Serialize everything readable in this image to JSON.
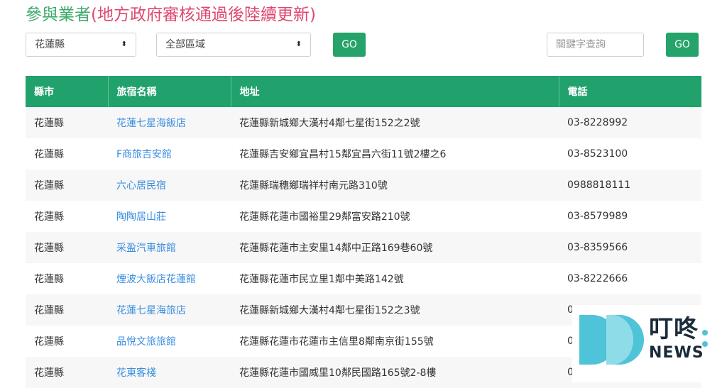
{
  "page": {
    "title_main": "參與業者",
    "title_note": "(地方政府審核通過後陸續更新)"
  },
  "filters": {
    "county": {
      "selected": "花蓮縣",
      "caret": "⬍"
    },
    "district": {
      "selected": "全部區域",
      "caret": "⬍"
    },
    "go_label": "GO",
    "keyword_placeholder": "關鍵字查詢",
    "search_go_label": "GO"
  },
  "table": {
    "headers": [
      "縣市",
      "旅宿名稱",
      "地址",
      "電話"
    ],
    "rows": [
      {
        "county": "花蓮縣",
        "name": "花蓮七星海飯店",
        "address": "花蓮縣新城鄉大漢村4鄰七星街152之2號",
        "phone": "03-8228992"
      },
      {
        "county": "花蓮縣",
        "name": "F商旅吉安館",
        "address": "花蓮縣吉安鄉宜昌村15鄰宜昌六街11號2樓之6",
        "phone": "03-8523100"
      },
      {
        "county": "花蓮縣",
        "name": "六心居民宿",
        "address": "花蓮縣瑞穗鄉瑞祥村南元路310號",
        "phone": "0988818111"
      },
      {
        "county": "花蓮縣",
        "name": "陶陶居山莊",
        "address": "花蓮縣花蓮市國裕里29鄰富安路210號",
        "phone": "03-8579989"
      },
      {
        "county": "花蓮縣",
        "name": "采盈汽車旅館",
        "address": "花蓮縣花蓮市主安里14鄰中正路169巷60號",
        "phone": "03-8359566"
      },
      {
        "county": "花蓮縣",
        "name": "煙波大飯店花蓮館",
        "address": "花蓮縣花蓮市民立里1鄰中美路142號",
        "phone": "03-8222666"
      },
      {
        "county": "花蓮縣",
        "name": "花蓮七星海旅店",
        "address": "花蓮縣新城鄉大漢村4鄰七星街152之3號",
        "phone": "03-8228992"
      },
      {
        "county": "花蓮縣",
        "name": "品悅文旅旅館",
        "address": "花蓮縣花蓮市花蓮市主信里8鄰南京街155號",
        "phone": "03-8"
      },
      {
        "county": "花蓮縣",
        "name": "花東客棧",
        "address": "花蓮縣花蓮市國威里10鄰民國路165號2-8樓",
        "phone": "03-8347368"
      }
    ]
  },
  "watermark": {
    "name_zh": "叮咚",
    "name_en": "NEWS",
    "colors": {
      "teal": "#4fc3d8",
      "dark": "#1a2a3a"
    }
  }
}
